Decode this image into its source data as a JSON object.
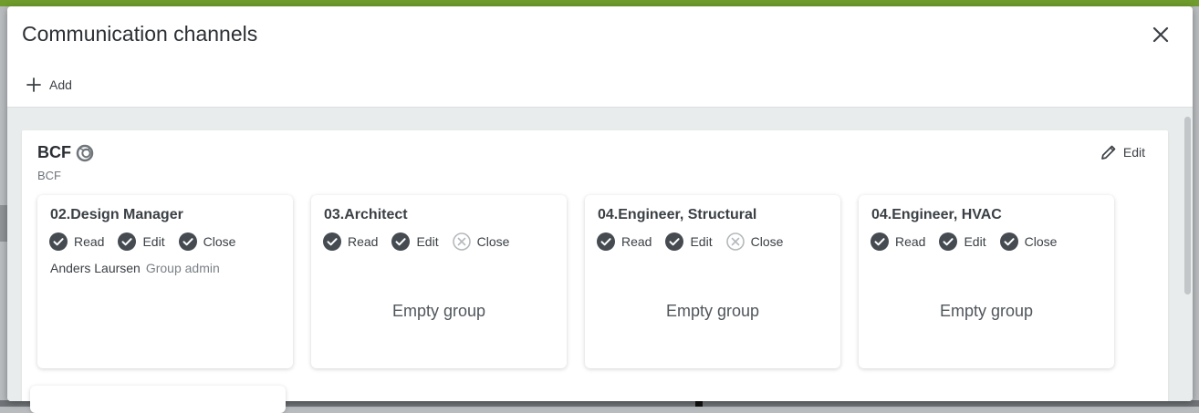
{
  "dialog": {
    "title": "Communication channels",
    "close_icon": "close-icon",
    "add_label": "Add"
  },
  "colors": {
    "app_bar": "#6f9c2c",
    "check": "#454b51",
    "denied": "#b5b9bc"
  },
  "channel": {
    "name": "BCF",
    "subtitle": "BCF",
    "icon": "channel-type-icon",
    "edit_label": "Edit",
    "groups": [
      {
        "title": "02.Design Manager",
        "permissions": [
          {
            "label": "Read",
            "granted": true
          },
          {
            "label": "Edit",
            "granted": true
          },
          {
            "label": "Close",
            "granted": true
          }
        ],
        "member_name": "Anders Laursen",
        "member_role": "Group admin"
      },
      {
        "title": "03.Architect",
        "permissions": [
          {
            "label": "Read",
            "granted": true
          },
          {
            "label": "Edit",
            "granted": true
          },
          {
            "label": "Close",
            "granted": false
          }
        ],
        "empty_text": "Empty group"
      },
      {
        "title": "04.Engineer, Structural",
        "permissions": [
          {
            "label": "Read",
            "granted": true
          },
          {
            "label": "Edit",
            "granted": true
          },
          {
            "label": "Close",
            "granted": false
          }
        ],
        "empty_text": "Empty group"
      },
      {
        "title": "04.Engineer, HVAC",
        "permissions": [
          {
            "label": "Read",
            "granted": true
          },
          {
            "label": "Edit",
            "granted": true
          },
          {
            "label": "Close",
            "granted": true
          }
        ],
        "empty_text": "Empty group"
      }
    ]
  }
}
